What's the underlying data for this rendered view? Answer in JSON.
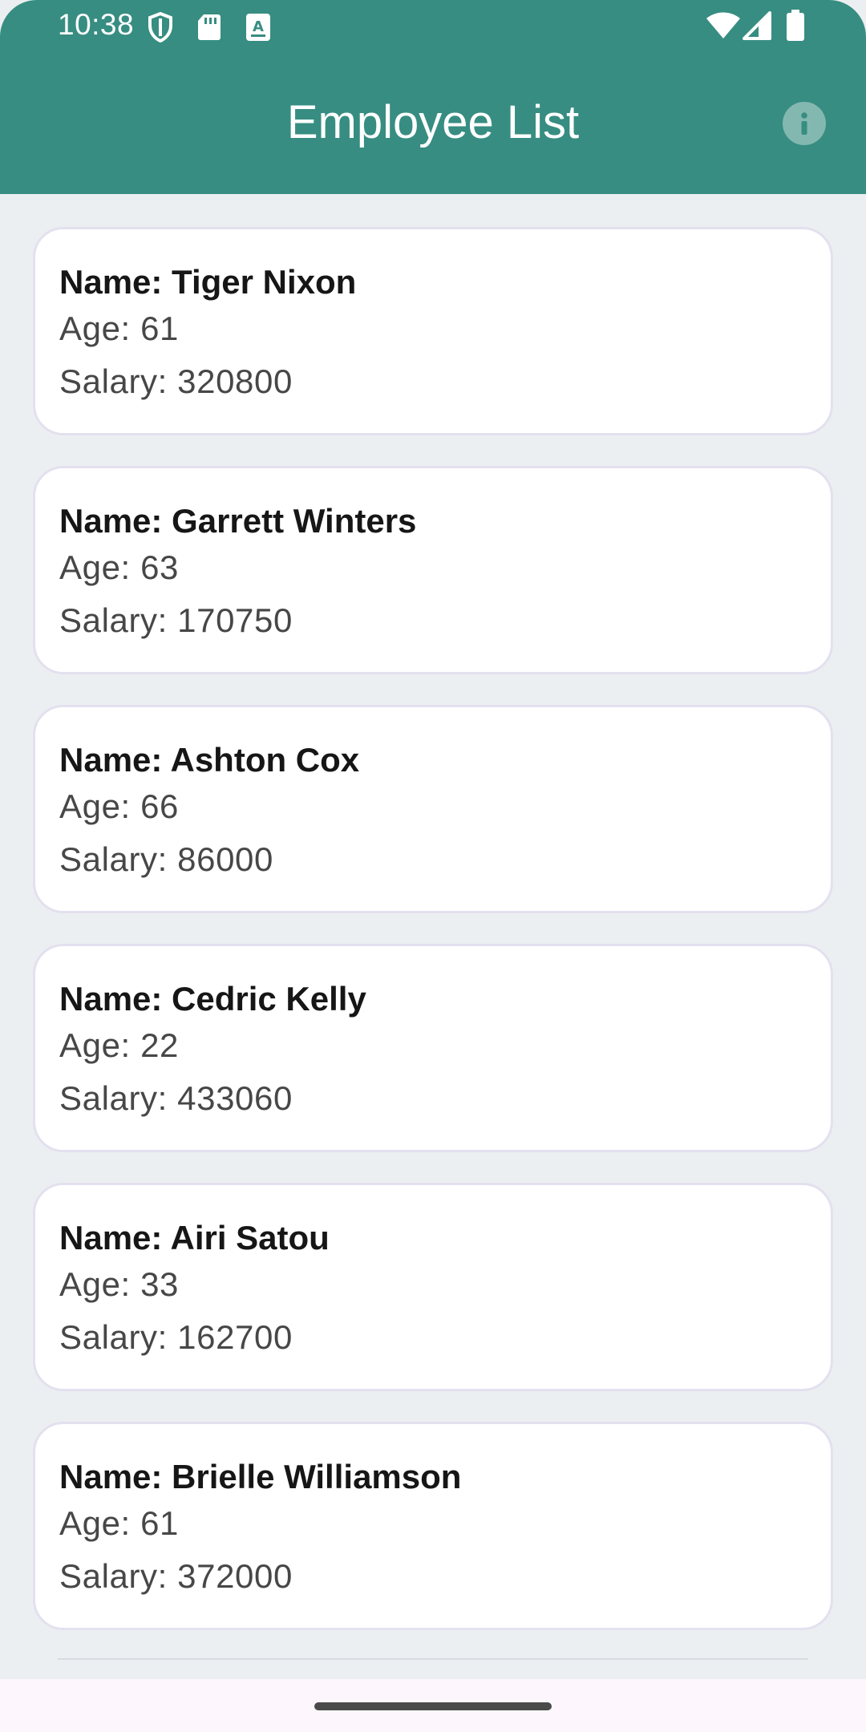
{
  "status_bar": {
    "time": "10:38",
    "left_icons": [
      "shield-icon",
      "sd-card-icon",
      "keyboard-a-icon"
    ],
    "right_icons": [
      "wifi-icon",
      "cellular-signal-icon",
      "battery-icon"
    ]
  },
  "app_bar": {
    "title": "Employee List",
    "action_icon": "info-icon",
    "background_color": "#378d81"
  },
  "employees": [
    {
      "name": "Name: Tiger Nixon",
      "age": "Age: 61",
      "salary": "Salary: 320800"
    },
    {
      "name": "Name: Garrett Winters",
      "age": "Age: 63",
      "salary": "Salary: 170750"
    },
    {
      "name": "Name: Ashton Cox",
      "age": "Age: 66",
      "salary": "Salary: 86000"
    },
    {
      "name": "Name: Cedric Kelly",
      "age": "Age: 22",
      "salary": "Salary: 433060"
    },
    {
      "name": "Name: Airi Satou",
      "age": "Age: 33",
      "salary": "Salary: 162700"
    },
    {
      "name": "Name: Brielle Williamson",
      "age": "Age: 61",
      "salary": "Salary: 372000"
    }
  ]
}
